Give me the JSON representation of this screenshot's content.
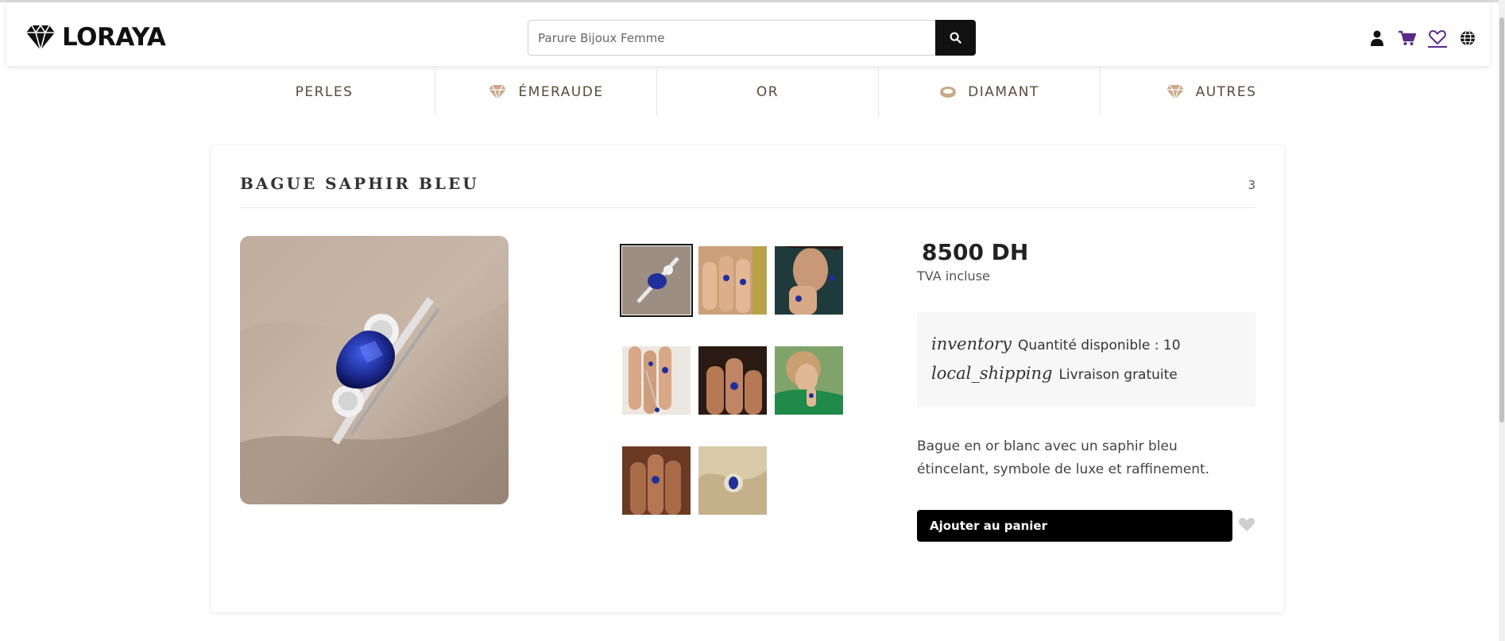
{
  "header": {
    "brand": "LORAYA",
    "search": {
      "placeholder": "Parure Bijoux Femme",
      "value": ""
    },
    "icons": [
      "user-icon",
      "cart-icon",
      "favorites-icon",
      "globe-icon"
    ]
  },
  "nav": {
    "items": [
      {
        "label": "PERLES",
        "icon": ""
      },
      {
        "label": "ÉMERAUDE",
        "icon": "gem-icon"
      },
      {
        "label": "OR",
        "icon": ""
      },
      {
        "label": "DIAMANT",
        "icon": "ring-icon"
      },
      {
        "label": "AUTRES",
        "icon": "gem-icon"
      }
    ]
  },
  "product": {
    "title": "BAGUE SAPHIR BLEU",
    "count": "3",
    "price": "8500 DH",
    "tax_note": "TVA incluse",
    "inventory_icon": "inventory",
    "inventory_text": "Quantité disponible : 10",
    "shipping_icon": "local_shipping",
    "shipping_text": "Livraison gratuite",
    "description": "Bague en or blanc avec un saphir bleu étincelant, symbole de luxe et raffinement.",
    "add_to_cart": "Ajouter au panier",
    "thumbnail_count": 8,
    "selected_thumbnail": 1
  },
  "colors": {
    "accent": "#000000",
    "nav_text": "#5a4a3c",
    "gem_icon": "#c9a98a",
    "cart_purple": "#5a2a8a",
    "sapphire": "#1f2f9a"
  }
}
